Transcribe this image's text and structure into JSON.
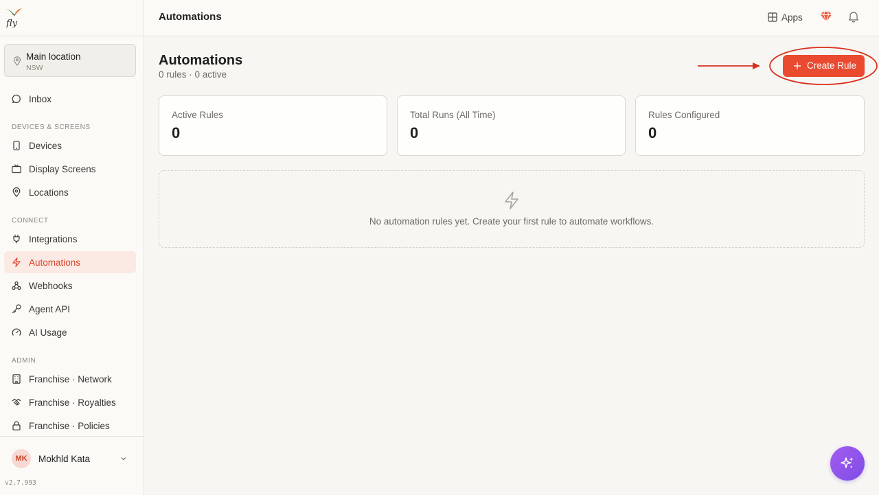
{
  "topbar": {
    "title": "Automations",
    "apps_label": "Apps"
  },
  "sidebar": {
    "location": {
      "name": "Main location",
      "region": "NSW"
    },
    "inbox_label": "Inbox",
    "sections": {
      "devices": "DEVICES & SCREENS",
      "connect": "CONNECT",
      "admin": "ADMIN"
    },
    "items": {
      "devices": "Devices",
      "display_screens": "Display Screens",
      "locations": "Locations",
      "integrations": "Integrations",
      "automations": "Automations",
      "webhooks": "Webhooks",
      "agent_api": "Agent API",
      "ai_usage": "AI Usage",
      "franchise_network": "Franchise · Network",
      "franchise_royalties": "Franchise · Royalties",
      "franchise_policies": "Franchise · Policies"
    },
    "user": {
      "initials": "MK",
      "name": "Mokhld Kata"
    },
    "version": "v2.7.993"
  },
  "main": {
    "title": "Automations",
    "subtitle": "0 rules · 0 active",
    "create_button_label": "Create Rule",
    "stats": [
      {
        "label": "Active Rules",
        "value": "0"
      },
      {
        "label": "Total Runs (All Time)",
        "value": "0"
      },
      {
        "label": "Rules Configured",
        "value": "0"
      }
    ],
    "empty_state_text": "No automation rules yet. Create your first rule to automate workflows."
  },
  "colors": {
    "accent": "#ea4a2f",
    "active_nav_bg": "#fbe9e4",
    "annotation": "#d92f1c",
    "fab": "#8e54ec"
  },
  "icons": {
    "logo": "fly-logo",
    "location": "map-pin-icon",
    "inbox": "chat-bubble-icon",
    "devices": "smartphone-icon",
    "display_screens": "tv-icon",
    "locations": "map-pin-icon",
    "integrations": "plug-icon",
    "automations": "lightning-icon",
    "webhooks": "webhook-icon",
    "agent_api": "key-icon",
    "ai_usage": "gauge-icon",
    "franchise_network": "building-icon",
    "franchise_royalties": "handshake-icon",
    "franchise_policies": "lock-icon",
    "apps": "grid-icon",
    "gem": "gem-icon",
    "bell": "bell-icon",
    "fab": "sparkles-icon"
  }
}
